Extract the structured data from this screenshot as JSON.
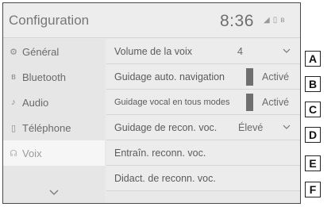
{
  "header": {
    "title": "Configuration",
    "clock": "8:36",
    "status_icons": [
      "signal-icon",
      "phone-icon",
      "bluetooth-icon"
    ]
  },
  "sidebar": {
    "items": [
      {
        "label": "Général",
        "icon": "gear-icon"
      },
      {
        "label": "Bluetooth",
        "icon": "bluetooth-icon"
      },
      {
        "label": "Audio",
        "icon": "music-note-icon"
      },
      {
        "label": "Téléphone",
        "icon": "phone-icon"
      },
      {
        "label": "Voix",
        "icon": "voice-icon",
        "active": true
      }
    ],
    "more_icon": "chevron-down-icon"
  },
  "settings": {
    "rows": [
      {
        "label": "Volume de la voix",
        "value": "4"
      },
      {
        "label": "Guidage auto. navigation",
        "value": "Activé"
      },
      {
        "label": "Guidage vocal en tous modes",
        "value": "Activé"
      },
      {
        "label": "Guidage de recon. voc.",
        "value": "Élevé"
      },
      {
        "label": "Entraîn. reconn. voc."
      },
      {
        "label": "Didact. de reconn. voc."
      }
    ]
  },
  "callouts": [
    "A",
    "B",
    "C",
    "D",
    "E",
    "F"
  ],
  "colors": {
    "toggle": "#6f6f6f",
    "background": "#e9e9e9",
    "border": "#4a4a4a"
  }
}
